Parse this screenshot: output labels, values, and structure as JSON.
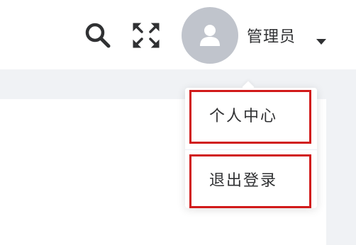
{
  "header": {
    "user_name": "管理员",
    "icons": {
      "search": "search-icon",
      "fullscreen": "fullscreen-icon",
      "avatar": "user-avatar-icon",
      "dropdown": "caret-down-icon"
    }
  },
  "dropdown_menu": {
    "items": [
      {
        "label": "个人中心"
      },
      {
        "label": "退出登录"
      }
    ],
    "highlight_color": "#d11a1a"
  },
  "colors": {
    "page_bg": "#f0f2f5",
    "avatar_bg": "#c0c4cc",
    "text": "#303133"
  }
}
